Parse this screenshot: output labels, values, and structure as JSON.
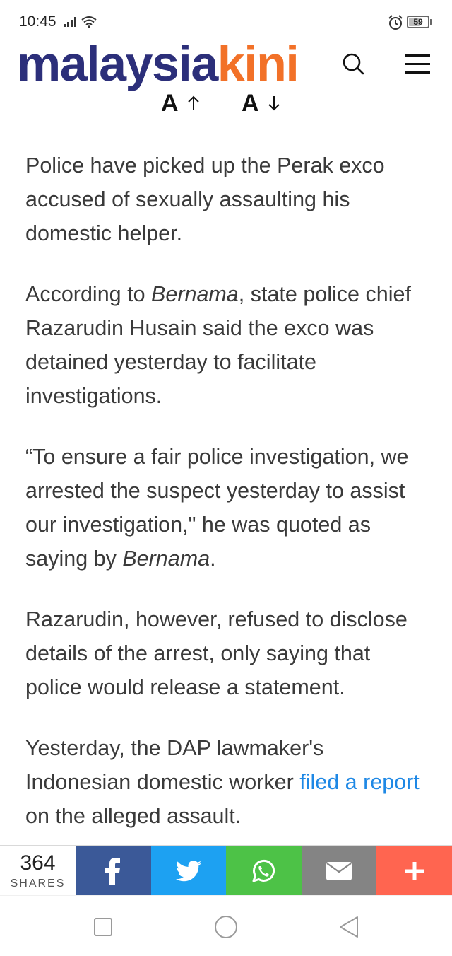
{
  "status_bar": {
    "time": "10:45",
    "battery": "59",
    "battery_level": 0.59
  },
  "header": {
    "logo_part1": "malaysia",
    "logo_part2": "kini",
    "logo_colors": {
      "part1": "#2c2f7a",
      "part2": "#f27128"
    },
    "icons": {
      "search": "search-icon",
      "menu": "hamburger-menu-icon"
    }
  },
  "font_controls": {
    "increase_label": "A",
    "decrease_label": "A"
  },
  "article": {
    "p1": "Police have picked up the Perak exco accused of sexually assaulting his domestic helper.",
    "p2_part1": "According to ",
    "p2_source": "Bernama",
    "p2_part2": ", state police chief Razarudin Husain said the exco was detained yesterday to facilitate investigations.",
    "p3_part1": "“To ensure a fair police investigation, we arrested the suspect yesterday to assist our investigation,\" he was quoted as saying by ",
    "p3_source": "Bernama",
    "p3_part2": ".",
    "p4": "Razarudin, however, refused to disclose details of the arrest, only saying that police would release a statement.",
    "p5_part1": "Yesterday, the DAP lawmaker's Indonesian domestic worker ",
    "p5_link": "filed a report",
    "p5_part2": " on the alleged assault.",
    "link_color": "#1e88e5"
  },
  "share_bar": {
    "count": "364",
    "count_label": "SHARES",
    "buttons": [
      {
        "name": "facebook",
        "icon": "facebook-icon",
        "color": "#3b5998"
      },
      {
        "name": "twitter",
        "icon": "twitter-icon",
        "color": "#1da1f2"
      },
      {
        "name": "whatsapp",
        "icon": "whatsapp-icon",
        "color": "#4dc247"
      },
      {
        "name": "email",
        "icon": "email-icon",
        "color": "#848484"
      },
      {
        "name": "more",
        "icon": "plus-icon",
        "color": "#ff6550"
      }
    ]
  },
  "nav_bar": {
    "icons": [
      "recents-square-icon",
      "home-circle-icon",
      "back-triangle-icon"
    ]
  }
}
